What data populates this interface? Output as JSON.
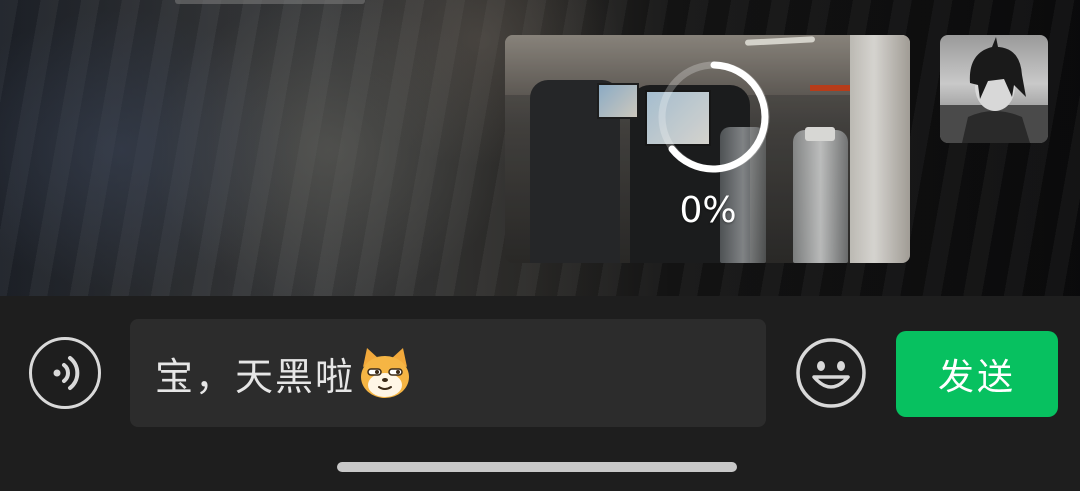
{
  "chat": {
    "image_message": {
      "upload_progress_text": "0%",
      "upload_progress": 0
    }
  },
  "composer": {
    "voice_icon": "voice-wave-icon",
    "message_text": "宝，天黑啦",
    "inline_emoji": "cat-face-emoji",
    "emoji_icon": "smiley-icon",
    "send_label": "发送"
  },
  "colors": {
    "send_button": "#07c160",
    "bar_background": "#1e1e1e",
    "input_background": "#2c2c2c"
  }
}
